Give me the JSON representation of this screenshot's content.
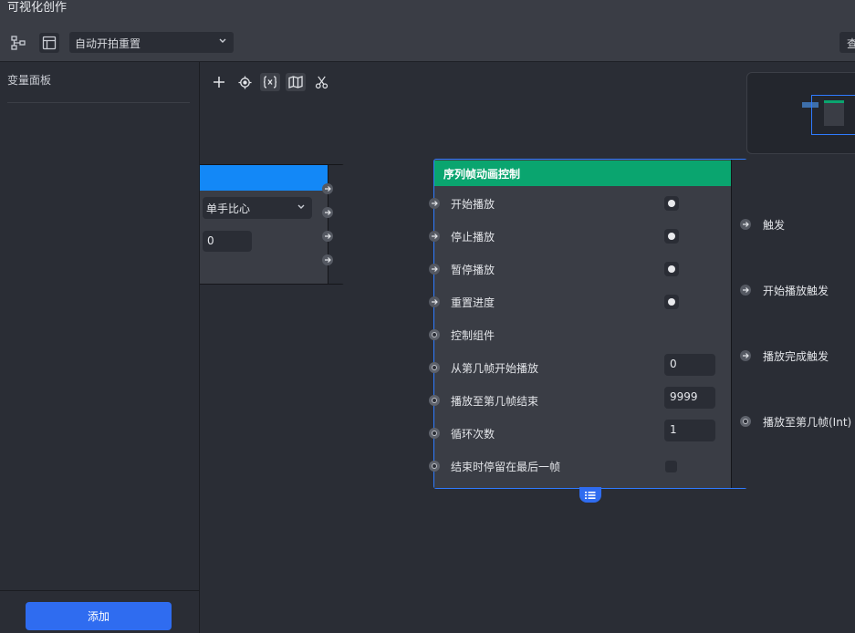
{
  "window": {
    "title": "可视化创作"
  },
  "toolbar": {
    "icons": [
      "node-tree-icon",
      "layout-icon"
    ],
    "mode_select": {
      "value": "自动开拍重置"
    },
    "right_button_label": "查"
  },
  "left_panel": {
    "title": "变量面板",
    "add_button": "添加"
  },
  "canvas_tools": [
    "plus-icon",
    "locate-icon",
    "variable-icon",
    "map-icon",
    "scissors-icon"
  ],
  "left_node": {
    "select_value": "单手比心",
    "input_value": "0"
  },
  "main_node": {
    "title": "序列帧动画控制",
    "header_color": "#0aa56f",
    "inputs": [
      {
        "label": "开始播放",
        "port": "exec",
        "control": "radio"
      },
      {
        "label": "停止播放",
        "port": "exec",
        "control": "radio"
      },
      {
        "label": "暂停播放",
        "port": "exec",
        "control": "radio"
      },
      {
        "label": "重置进度",
        "port": "exec",
        "control": "radio"
      },
      {
        "label": "控制组件",
        "port": "data",
        "control": "none"
      },
      {
        "label": "从第几帧开始播放",
        "port": "data",
        "control": "number",
        "value": "0"
      },
      {
        "label": "播放至第几帧结束",
        "port": "data",
        "control": "number",
        "value": "9999"
      },
      {
        "label": "循环次数",
        "port": "data",
        "control": "number",
        "value": "1"
      },
      {
        "label": "结束时停留在最后一帧",
        "port": "data",
        "control": "checkbox"
      }
    ],
    "outputs": [
      {
        "label": "触发",
        "port": "exec"
      },
      {
        "label": "开始播放触发",
        "port": "exec"
      },
      {
        "label": "播放完成触发",
        "port": "exec"
      },
      {
        "label": "播放至第几帧(Int)",
        "port": "data"
      }
    ]
  },
  "colors": {
    "accent": "#2f6cf0",
    "node_selected_border": "#2f7bff",
    "left_node_header": "#1388f7"
  }
}
